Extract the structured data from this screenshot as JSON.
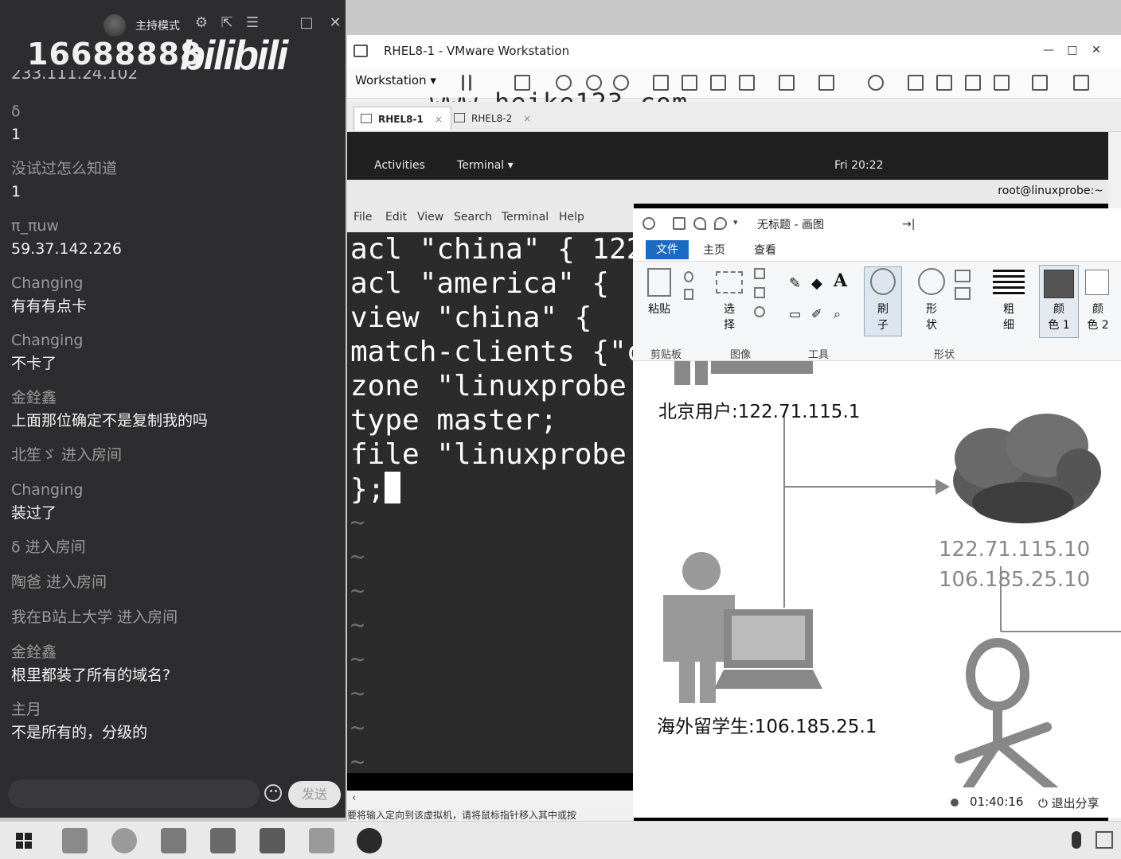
{
  "chat": {
    "host_mode": "主持模式",
    "room_number": "16688888",
    "bili_logo": "bilibili",
    "partial_ip": "233.111.24.102",
    "messages": [
      {
        "name": "δ",
        "text": "1"
      },
      {
        "name": "没试过怎么知道",
        "text": "1"
      },
      {
        "name": "π_πuw",
        "text": "59.37.142.226"
      },
      {
        "name": "Changing",
        "text": "有有有点卡"
      },
      {
        "name": "Changing",
        "text": "不卡了"
      },
      {
        "name": "金銓鑫",
        "text": "上面那位确定不是复制我的吗"
      },
      {
        "name": "北笙ゞ 进入房间",
        "text": ""
      },
      {
        "name": "Changing",
        "text": "装过了"
      },
      {
        "name": "δ 进入房间",
        "text": ""
      },
      {
        "name": "陶爸 进入房间",
        "text": ""
      },
      {
        "name": "我在B站上大学 进入房间",
        "text": ""
      },
      {
        "name": "金銓鑫",
        "text": "根里都装了所有的域名?"
      },
      {
        "name": "主月",
        "text": "不是所有的，分级的"
      }
    ],
    "send_label": "发送"
  },
  "vmware": {
    "title": "RHEL8-1 - VMware Workstation",
    "menu_label": "Workstation",
    "watermark": "www.heike123.com",
    "tabs": [
      {
        "label": "RHEL8-1",
        "close": "×"
      },
      {
        "label": "RHEL8-2",
        "close": "×"
      }
    ]
  },
  "gnome": {
    "activities": "Activities",
    "terminal_menu": "Terminal ▾",
    "clock": "Fri 20:22",
    "term_title": "root@linuxprobe:~"
  },
  "terminal": {
    "menu": [
      "File",
      "Edit",
      "View",
      "Search",
      "Terminal",
      "Help"
    ],
    "lines": [
      "acl \"china\" { 122",
      "acl \"america\" {",
      "view \"china\" {",
      "match-clients {\"c",
      "zone \"linuxprobe",
      "type master;",
      "file \"linuxprobe",
      "};"
    ],
    "tilde": "~",
    "status_hint": "要将输入定向到该虚拟机，请将鼠标指针移入其中或按"
  },
  "paint": {
    "doc_title": "无标题 - 画图",
    "tabs": {
      "file": "文件",
      "home": "主页",
      "view": "查看"
    },
    "buttons": {
      "paste": "粘贴",
      "select": "选\n择",
      "brush": "刷\n子",
      "shapes": "形\n状",
      "size": "粗\n细",
      "color1": "颜\n色 1",
      "color2": "颜\n色 2"
    },
    "groups": {
      "clipboard": "剪贴板",
      "image": "图像",
      "tools": "工具",
      "shapes": "形状"
    },
    "diagram": {
      "beijing_user": "北京用户:122.71.115.1",
      "overseas_student": "海外留学生:106.185.25.1",
      "server_ip_1": "122.71.115.10",
      "server_ip_2": "106.185.25.10"
    }
  },
  "share": {
    "timer": "01:40:16",
    "exit": "退出分享"
  }
}
